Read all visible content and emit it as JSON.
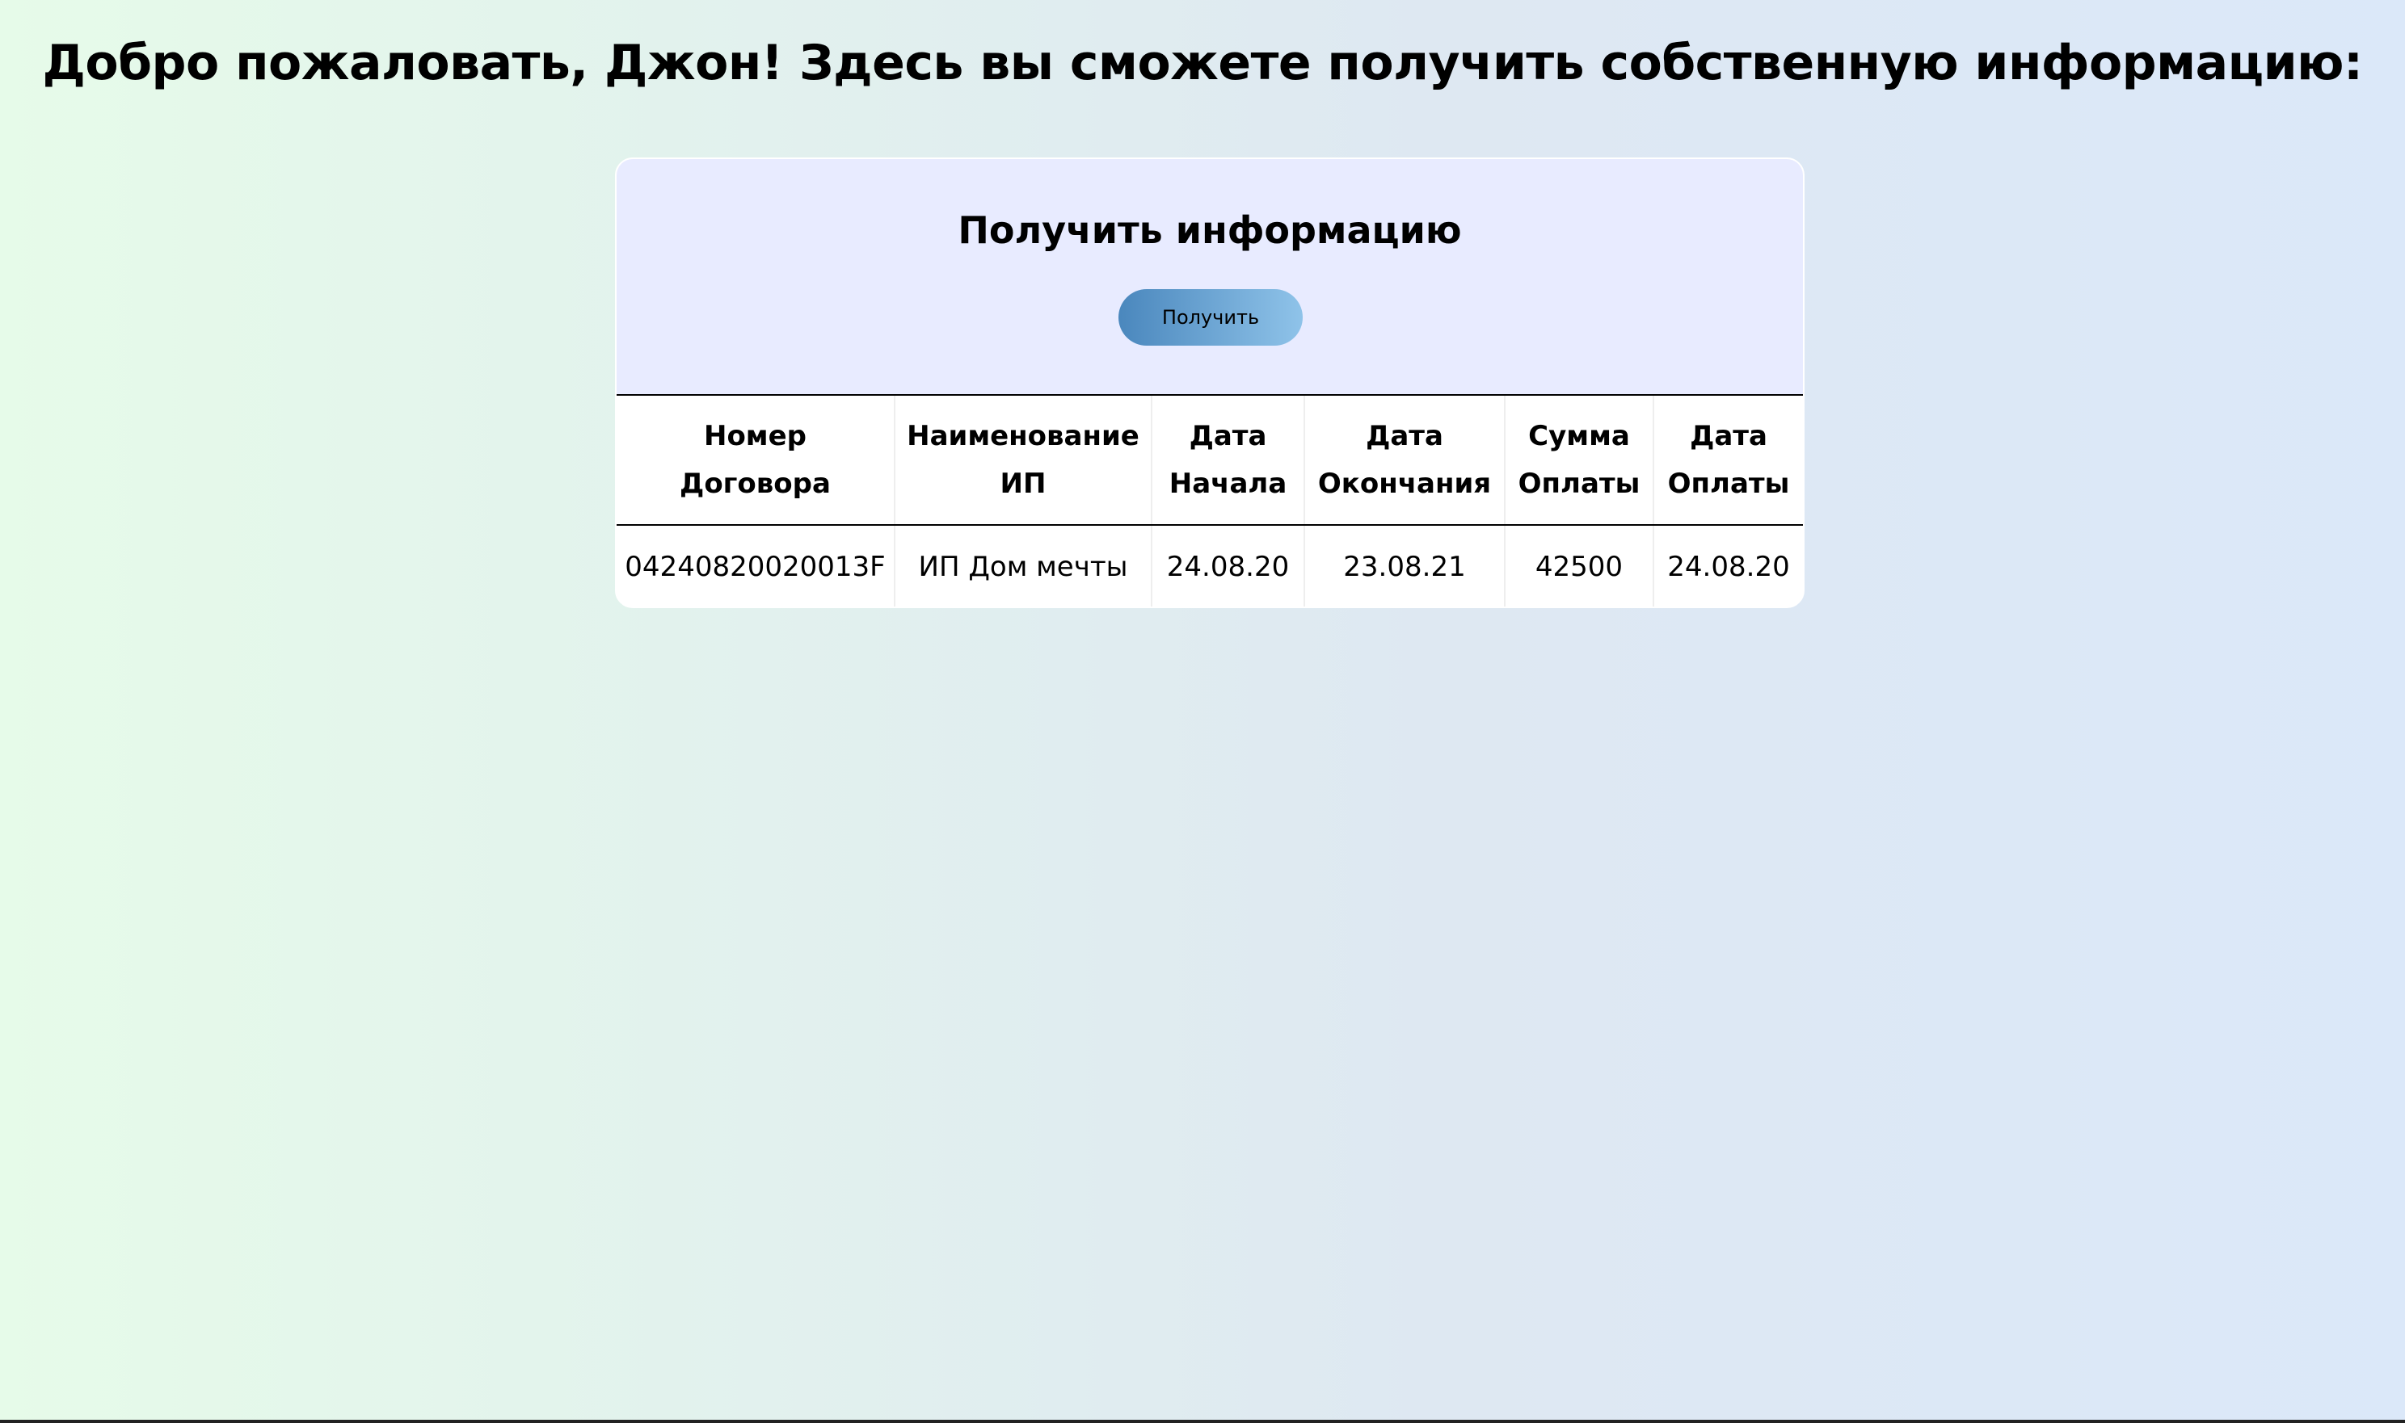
{
  "page": {
    "title": "Добро пожаловать, Джон! Здесь вы сможете получить собственную информацию:"
  },
  "card": {
    "title": "Получить информацию",
    "button_label": "Получить"
  },
  "table": {
    "headers": [
      "Номер Договора",
      "Наименование ИП",
      "Дата Начала",
      "Дата Окончания",
      "Сумма Оплаты",
      "Дата Оплаты"
    ],
    "rows": [
      [
        "04240820020013F",
        "ИП Дом мечты",
        "24.08.20",
        "23.08.21",
        "42500",
        "24.08.20"
      ]
    ]
  },
  "colors": {
    "background_left": "#e6fbe9",
    "background_right": "#dbe8f9",
    "card_header": "#e8ebff",
    "button_left": "#4a87bd",
    "button_right": "#8fc3e9"
  }
}
